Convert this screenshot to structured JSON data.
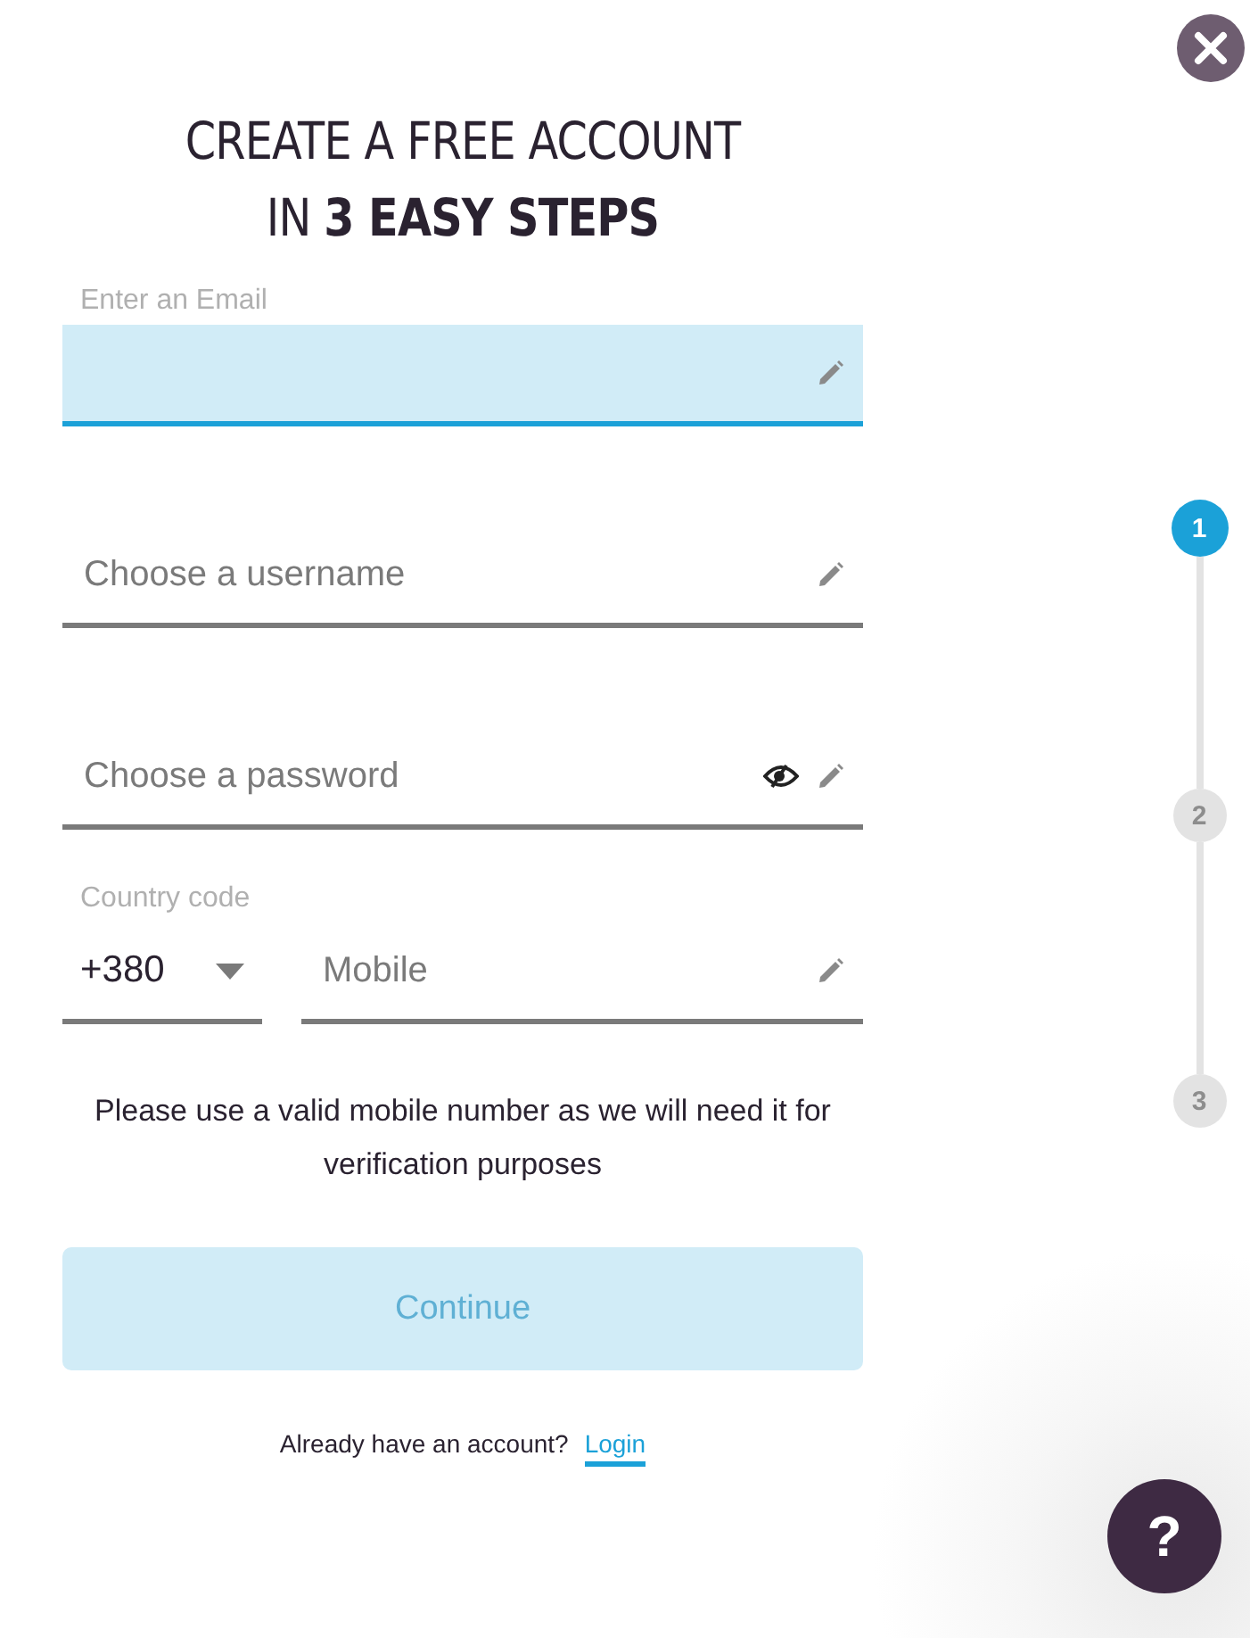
{
  "title": {
    "line_1": "CREATE A FREE ACCOUNT",
    "line_2": "IN **3 EASY STEPS**"
  },
  "fields": [
    {
      "kind": "text",
      "label": "Enter an Email",
      "focused": true
    },
    {
      "kind": "text",
      "placeholder": "Choose a username",
      "focused": false
    },
    {
      "kind": "password",
      "placeholder": "Choose a password",
      "focused": false
    }
  ],
  "phone": {
    "country_label": "Country code",
    "country_value": "+380",
    "mobile_placeholder": "Mobile"
  },
  "note": "Please use a valid mobile number as we will need it for verification purposes",
  "continue_button": {
    "label": "Continue",
    "disabled": true
  },
  "login": {
    "prompt": "Already have an account?",
    "link": "Login"
  },
  "steps": [
    {
      "label": "1",
      "selected": true
    },
    {
      "label": "2",
      "selected": false
    },
    {
      "label": "3",
      "selected": false
    }
  ],
  "help_button": {
    "label": "?"
  }
}
